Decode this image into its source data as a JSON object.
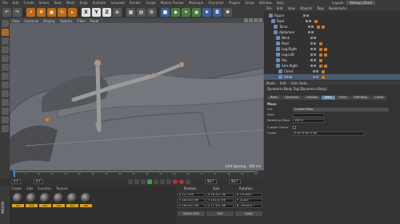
{
  "menubar": {
    "items": [
      "File",
      "Edit",
      "Create",
      "Select",
      "Tools",
      "Mesh",
      "Snap",
      "Animate",
      "Simulate",
      "Render",
      "Sculpt",
      "Motion Tracker",
      "MoGraph",
      "Character",
      "Plugins",
      "Script",
      "Window",
      "Help"
    ],
    "layout_label": "Layout:",
    "layout_value": "Startup (User)"
  },
  "toolbar": {
    "axis_x": "X",
    "axis_y": "Y",
    "axis_z": "Z"
  },
  "viewport": {
    "menu": [
      "View",
      "Cameras",
      "Display",
      "Options",
      "Filter",
      "Panel"
    ],
    "grid_label": "Grid Spacing : 100 cm"
  },
  "timeline": {
    "ticks": [
      "0",
      "5",
      "10",
      "15",
      "20",
      "25",
      "30",
      "35",
      "40",
      "45",
      "50",
      "55",
      "60",
      "65",
      "70",
      "75",
      "80",
      "85",
      "90"
    ],
    "frame_left": "0 F",
    "frame_right": "90 F"
  },
  "materials": {
    "menu": [
      "Create",
      "Edit",
      "Function",
      "Texture"
    ],
    "items": [
      "Mat",
      "Mat",
      "Mat",
      "Mat",
      "Mat",
      "Mat"
    ]
  },
  "coords": {
    "headers": [
      "Position",
      "Size",
      "Rotation"
    ],
    "rows": [
      [
        "X 12.1 cm",
        "X 16.321 cm",
        "H 130.653 °"
      ],
      [
        "Y 160.543 cm",
        "Y 255.51 cm",
        "P -8.103 °"
      ],
      [
        "Z 181.957 cm",
        "Z 17.191 cm",
        "B -199.874 °"
      ]
    ],
    "mode": "Object (Rel)",
    "size_mode": "Size",
    "apply": "Apply"
  },
  "object_manager": {
    "menu": [
      "File",
      "Edit",
      "View",
      "Objects",
      "Tags",
      "Bookmarks"
    ],
    "objects": [
      "Figure",
      "Root",
      "Torso",
      "Abdomen",
      "Neck",
      "Root",
      "Leg.Right",
      "Leg.Left",
      "Hip",
      "Arm.Right",
      "Chest",
      "Head"
    ]
  },
  "attributes": {
    "menu": [
      "Mode",
      "Edit",
      "User Data"
    ],
    "title": "Dynamics Body Tag [Dynamics Body]",
    "tabs": [
      "Basic",
      "Dynamics",
      "Collision",
      "Mass",
      "Force",
      "Soft Body",
      "Cache"
    ],
    "active_tab": "Mass",
    "section": "Mass",
    "rows": [
      {
        "label": "Use",
        "value": "Custom Mass"
      },
      {
        "label": "Mass",
        "value": ""
      },
      {
        "label": "Rotational Mass",
        "value": "100 %"
      },
      {
        "label": "Custom Center",
        "value": ""
      },
      {
        "label": "Center",
        "value": "0 cm     0 cm     0 cm"
      }
    ]
  }
}
